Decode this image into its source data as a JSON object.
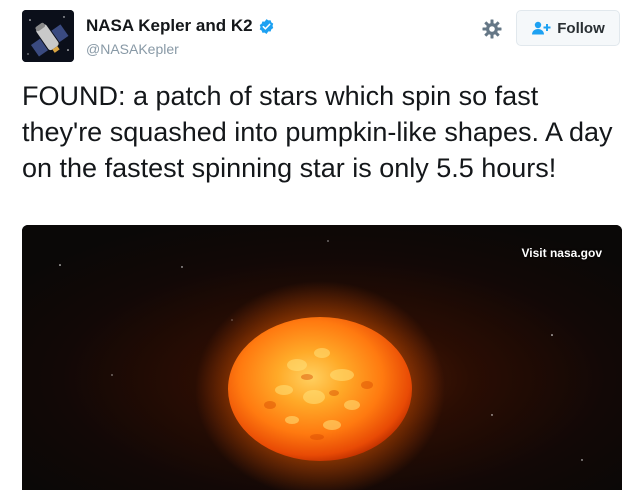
{
  "author": {
    "display_name": "NASA Kepler and K2",
    "handle": "@NASAKepler",
    "verified": true,
    "avatar_icon": "kepler-spacecraft-avatar"
  },
  "actions": {
    "settings_icon": "gear-icon",
    "follow_label": "Follow",
    "follow_icon": "add-user-icon"
  },
  "tweet": {
    "text": "FOUND: a patch of stars which spin so fast they're squashed into pumpkin-like shapes. A day on the fastest spinning star is only 5.5 hours!"
  },
  "media": {
    "link_label": "Visit nasa.gov",
    "image_subject": "fast-spinning-orange-star",
    "colors": {
      "star_core": "#ffb030",
      "star_edge": "#e03a00",
      "space": "#0a0807"
    }
  },
  "colors": {
    "text": "#14171a",
    "handle": "#8899a6",
    "verified": "#1da1f2",
    "button_bg": "#f5f8fa",
    "button_border": "#e1e8ed"
  }
}
